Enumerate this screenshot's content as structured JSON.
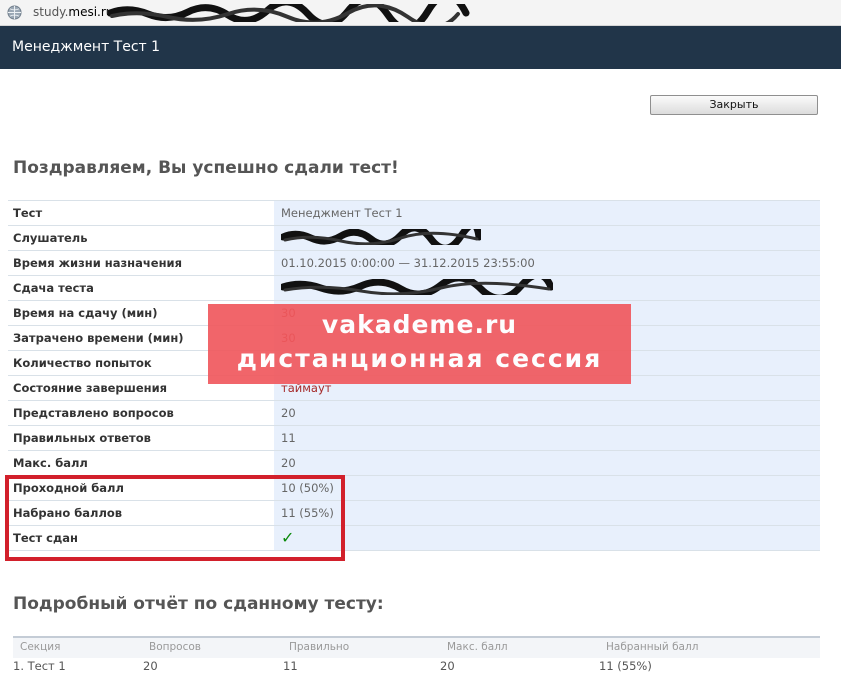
{
  "browser": {
    "url_prefix": "study.",
    "url_host": "mesi.ru"
  },
  "header": {
    "title": "Менеджмент Тест 1"
  },
  "toolbar": {
    "close_label": "Закрыть"
  },
  "congrats": "Поздравляем, Вы успешно сдали тест!",
  "rows": [
    {
      "label": "Тест",
      "value": "Менеджмент Тест 1"
    },
    {
      "label": "Слушатель",
      "value": ""
    },
    {
      "label": "Время жизни назначения",
      "value": "01.10.2015 0:00:00 — 31.12.2015 23:55:00"
    },
    {
      "label": "Сдача теста",
      "value": ""
    },
    {
      "label": "Время на сдачу (мин)",
      "value": "30"
    },
    {
      "label": "Затрачено времени (мин)",
      "value": "30"
    },
    {
      "label": "Количество попыток",
      "value": ""
    },
    {
      "label": "Состояние завершения",
      "value": "таймаут"
    },
    {
      "label": "Представлено вопросов",
      "value": "20"
    },
    {
      "label": "Правильных ответов",
      "value": "11"
    },
    {
      "label": "Макс. балл",
      "value": "20"
    },
    {
      "label": "Проходной балл",
      "value": "10 (50%)"
    },
    {
      "label": "Набрано баллов",
      "value": "11 (55%)"
    },
    {
      "label": "Тест сдан",
      "value": "✓"
    }
  ],
  "watermark": {
    "line1": "vakademe.ru",
    "line2": "дистанционная сессия"
  },
  "report": {
    "title": "Подробный отчёт по сданному тесту:",
    "columns": [
      "Секция",
      "Вопросов",
      "Правильно",
      "Макс. балл",
      "Набранный балл"
    ],
    "rows": [
      [
        "1. Тест 1",
        "20",
        "11",
        "20",
        "11 (55%)"
      ]
    ]
  },
  "colors": {
    "header_bg": "#213549",
    "value_bg": "#e8f0fc",
    "highlight": "#d2202b",
    "watermark": "#f0595e",
    "check": "#0a8a0a"
  },
  "icons": {
    "address_bar": "globe-icon",
    "passed": "checkmark-icon"
  }
}
